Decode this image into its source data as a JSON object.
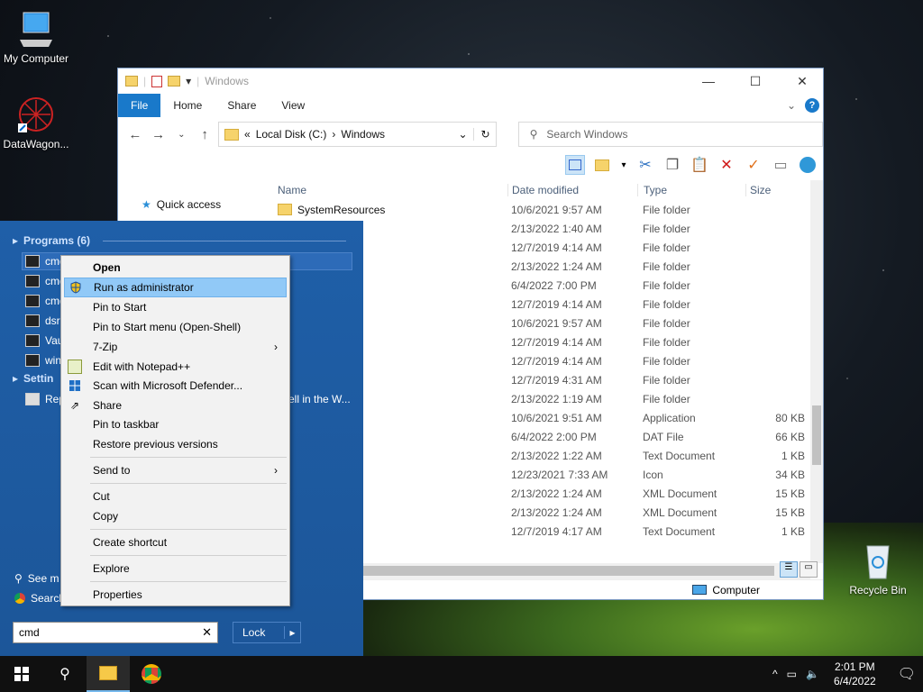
{
  "desktop": {
    "icons": [
      {
        "label": "My Computer",
        "icon": "computer-icon"
      },
      {
        "label": "DataWagon...",
        "icon": "app-shortcut-icon"
      },
      {
        "label": "Recycle Bin",
        "icon": "recycle-bin-icon"
      }
    ]
  },
  "explorer": {
    "title": "Windows",
    "tabs": [
      "File",
      "Home",
      "Share",
      "View"
    ],
    "address": {
      "prefix": "«",
      "parts": [
        "Local Disk (C:)",
        "Windows"
      ]
    },
    "search_placeholder": "Search Windows",
    "nav": {
      "quick_access": "Quick access"
    },
    "columns": {
      "name": "Name",
      "date": "Date modified",
      "type": "Type",
      "size": "Size"
    },
    "rows": [
      {
        "name": "SystemResources",
        "date": "10/6/2021 9:57 AM",
        "type": "File folder",
        "size": ""
      },
      {
        "name": "",
        "date": "2/13/2022 1:40 AM",
        "type": "File folder",
        "size": ""
      },
      {
        "name": "",
        "date": "12/7/2019 4:14 AM",
        "type": "File folder",
        "size": ""
      },
      {
        "name": "",
        "date": "2/13/2022 1:24 AM",
        "type": "File folder",
        "size": ""
      },
      {
        "name": "",
        "date": "6/4/2022 7:00 PM",
        "type": "File folder",
        "size": ""
      },
      {
        "name": "",
        "date": "12/7/2019 4:14 AM",
        "type": "File folder",
        "size": ""
      },
      {
        "name": "",
        "date": "10/6/2021 9:57 AM",
        "type": "File folder",
        "size": ""
      },
      {
        "name": "",
        "date": "12/7/2019 4:14 AM",
        "type": "File folder",
        "size": ""
      },
      {
        "name": "",
        "date": "12/7/2019 4:14 AM",
        "type": "File folder",
        "size": ""
      },
      {
        "name": "",
        "date": "12/7/2019 4:31 AM",
        "type": "File folder",
        "size": ""
      },
      {
        "name": "",
        "date": "2/13/2022 1:19 AM",
        "type": "File folder",
        "size": ""
      },
      {
        "name": "",
        "date": "10/6/2021 9:51 AM",
        "type": "Application",
        "size": "80 KB"
      },
      {
        "name": "",
        "date": "6/4/2022 2:00 PM",
        "type": "DAT File",
        "size": "66 KB"
      },
      {
        "name": "",
        "date": "2/13/2022 1:22 AM",
        "type": "Text Document",
        "size": "1 KB"
      },
      {
        "name": "",
        "date": "12/23/2021 7:33 AM",
        "type": "Icon",
        "size": "34 KB"
      },
      {
        "name": "",
        "date": "2/13/2022 1:24 AM",
        "type": "XML Document",
        "size": "15 KB"
      },
      {
        "name": "",
        "date": "2/13/2022 1:24 AM",
        "type": "XML Document",
        "size": "15 KB"
      },
      {
        "name": "",
        "date": "12/7/2019 4:17 AM",
        "type": "Text Document",
        "size": "1 KB"
      }
    ],
    "status": "Computer"
  },
  "startmenu": {
    "programs_header": "Programs (6)",
    "settings_header": "Settin",
    "programs": [
      "cmd",
      "cmd",
      "cmd",
      "dsre",
      "Vau",
      "win"
    ],
    "settings_item": "Rep",
    "partial_text": "ell in the W...",
    "see_more": "See m",
    "search_web": "Search",
    "search_value": "cmd",
    "lock": "Lock"
  },
  "context_menu": {
    "items": [
      {
        "label": "Open",
        "bold": true
      },
      {
        "label": "Run as administrator",
        "highlight": true,
        "icon": "shield-icon"
      },
      {
        "label": "Pin to Start"
      },
      {
        "label": "Pin to Start menu (Open-Shell)"
      },
      {
        "label": "7-Zip",
        "submenu": true
      },
      {
        "label": "Edit with Notepad++",
        "icon": "notepad-icon"
      },
      {
        "label": "Scan with Microsoft Defender...",
        "icon": "defender-icon"
      },
      {
        "label": "Share",
        "icon": "share-icon"
      },
      {
        "label": "Pin to taskbar"
      },
      {
        "label": "Restore previous versions"
      },
      {
        "label": "Send to",
        "submenu": true
      },
      {
        "label": "Cut"
      },
      {
        "label": "Copy"
      },
      {
        "label": "Create shortcut"
      },
      {
        "label": "Explore"
      },
      {
        "label": "Properties"
      }
    ]
  },
  "taskbar": {
    "time": "2:01 PM",
    "date": "6/4/2022"
  }
}
